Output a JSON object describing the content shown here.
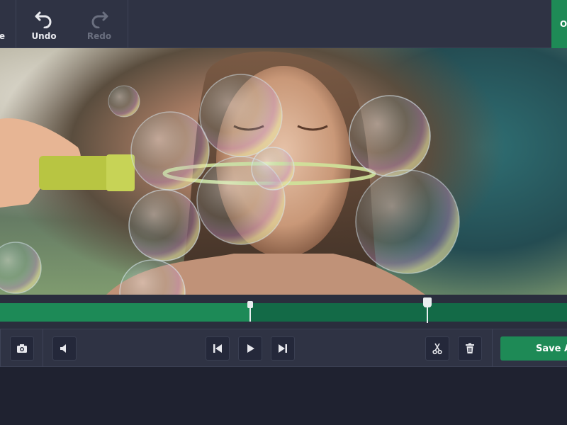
{
  "toolbar": {
    "store_label": "re",
    "undo_label": "Undo",
    "redo_label": "Redo",
    "open_label": "Op"
  },
  "preview": {
    "description": "video-frame"
  },
  "timeline": {
    "trim_end_fraction": 0.44,
    "playhead_fraction": 0.752
  },
  "controls": {
    "save_label": "Save As"
  },
  "colors": {
    "accent": "#1e8a56",
    "track": "#136a47",
    "toolbar": "#2f3344",
    "background": "#1f2230"
  }
}
